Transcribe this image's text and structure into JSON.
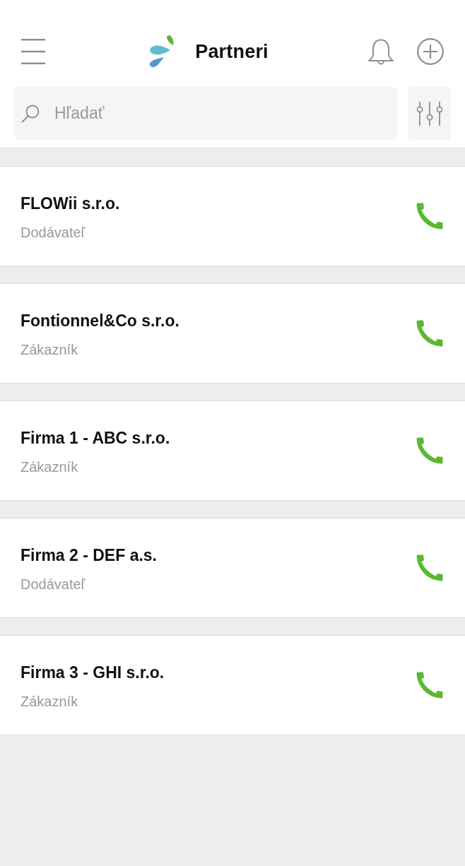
{
  "header": {
    "title": "Partneri"
  },
  "search": {
    "placeholder": "Hľadať"
  },
  "partners": [
    {
      "name": "FLOWii s.r.o.",
      "role": "Dodávateľ"
    },
    {
      "name": "Fontionnel&Co s.r.o.",
      "role": "Zákazník"
    },
    {
      "name": "Firma 1 - ABC s.r.o.",
      "role": "Zákazník"
    },
    {
      "name": "Firma 2 - DEF a.s.",
      "role": "Dodávateľ"
    },
    {
      "name": "Firma 3 - GHI s.r.o.",
      "role": "Zákazník"
    }
  ]
}
